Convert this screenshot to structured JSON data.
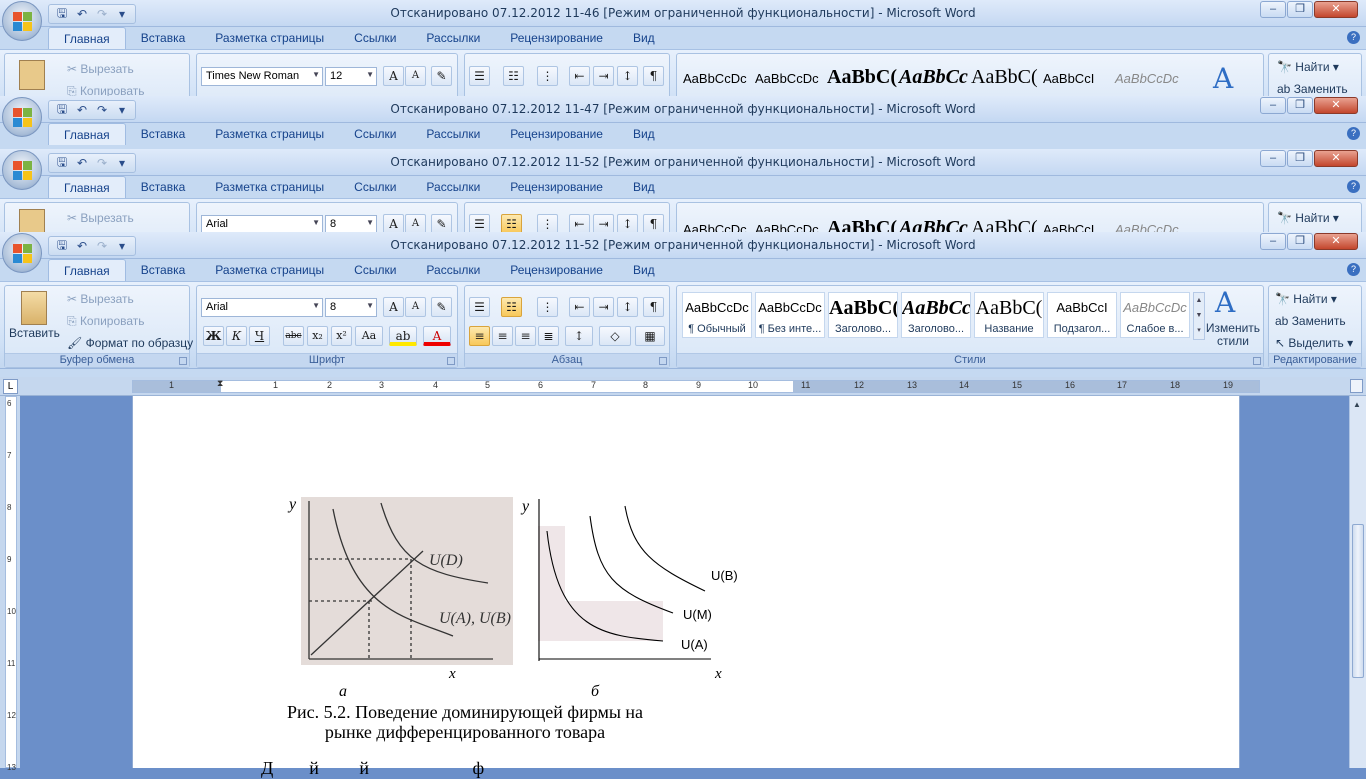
{
  "windows": [
    {
      "title": "Отсканировано 07.12.2012 11-46 [Режим ограниченной функциональности]  -  Microsoft Word",
      "font": "Times New Roman",
      "size": "12"
    },
    {
      "title": "Отсканировано 07.12.2012 11-47 [Режим ограниченной функциональности]  -  Microsoft Word"
    },
    {
      "title": "Отсканировано 07.12.2012 11-52 [Режим ограниченной функциональности]  -  Microsoft Word",
      "font": "Arial",
      "size": "8"
    },
    {
      "title": "Отсканировано 07.12.2012 11-52 [Режим ограниченной функциональности]  -  Microsoft Word",
      "font": "Arial",
      "size": "8"
    }
  ],
  "tabs": [
    "Главная",
    "Вставка",
    "Разметка страницы",
    "Ссылки",
    "Рассылки",
    "Рецензирование",
    "Вид"
  ],
  "clipboard": {
    "paste": "Вставить",
    "cut": "Вырезать",
    "copy": "Копировать",
    "format_painter": "Формат по образцу",
    "group": "Буфер обмена"
  },
  "font_group": {
    "group": "Шрифт",
    "bold": "Ж",
    "italic": "К",
    "underline": "Ч",
    "strike": "abc",
    "sub": "x₂",
    "sup": "x²",
    "case": "Aa",
    "grow": "A",
    "shrink": "A"
  },
  "paragraph_group": {
    "group": "Абзац",
    "pilcrow": "¶"
  },
  "styles": {
    "group": "Стили",
    "items": [
      {
        "sample": "AaBbCcDc",
        "name": "¶ Обычный"
      },
      {
        "sample": "AaBbCcDc",
        "name": "¶ Без инте..."
      },
      {
        "sample": "AaBbC(",
        "name": "Заголово..."
      },
      {
        "sample": "AaBbCc",
        "name": "Заголово..."
      },
      {
        "sample": "AaBbC(",
        "name": "Название"
      },
      {
        "sample": "AaBbCcI",
        "name": "Подзагол..."
      },
      {
        "sample": "AaBbCcDc",
        "name": "Слабое в..."
      }
    ],
    "change": "Изменить стили"
  },
  "editing": {
    "group": "Редактирование",
    "find": "Найти",
    "replace": "Заменить",
    "select": "Выделить"
  },
  "ruler_numbers": [
    "1",
    "1",
    "2",
    "3",
    "4",
    "5",
    "6",
    "7",
    "8",
    "9",
    "10",
    "11",
    "12",
    "13",
    "14",
    "15",
    "16",
    "17",
    "18",
    "19"
  ],
  "vruler_numbers": [
    "6",
    "7",
    "8",
    "9",
    "10",
    "11",
    "12",
    "13"
  ],
  "document": {
    "fig_a": {
      "y": "y",
      "x": "x",
      "label_d": "U(D)",
      "label_ab": "U(A), U(B)",
      "sub": "а"
    },
    "fig_b": {
      "y": "y",
      "x": "x",
      "label_b": "U(B)",
      "label_m": "U(M)",
      "label_a": "U(A)",
      "sub": "б"
    },
    "caption1": "Рис. 5.2. Поведение доминирующей фирмы на",
    "caption2": "рынке дифференцированного товара",
    "next_line": "Д        й         й                       ф"
  }
}
